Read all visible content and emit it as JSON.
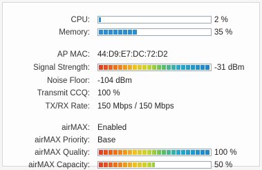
{
  "colors": {
    "border": "#9aa6b2",
    "bar_blue": "#2a8ed0",
    "heat_low": "#e03a22",
    "heat_mid": "#f2c01d",
    "heat_high": "#1f83cc"
  },
  "cpu": {
    "label": "CPU:",
    "percent": 2,
    "percent_text": "2 %"
  },
  "memory": {
    "label": "Memory:",
    "percent": 35,
    "percent_text": "35 %"
  },
  "ap_mac": {
    "label": "AP MAC:",
    "value": "44:D9:E7:DC:72:D2"
  },
  "signal_strength": {
    "label": "Signal Strength:",
    "level": 1.0,
    "value": "-31 dBm"
  },
  "noise_floor": {
    "label": "Noise Floor:",
    "value": "-104 dBm"
  },
  "transmit_ccq": {
    "label": "Transmit CCQ:",
    "value": "100 %"
  },
  "txrx_rate": {
    "label": "TX/RX Rate:",
    "value": "150 Mbps / 150 Mbps"
  },
  "airmax": {
    "label": "airMAX:",
    "value": "Enabled"
  },
  "airmax_priority": {
    "label": "airMAX Priority:",
    "value": "Base"
  },
  "airmax_quality": {
    "label": "airMAX Quality:",
    "percent": 100,
    "percent_text": "100 %"
  },
  "airmax_capacity": {
    "label": "airMAX Capacity:",
    "percent": 50,
    "percent_text": "50 %"
  }
}
